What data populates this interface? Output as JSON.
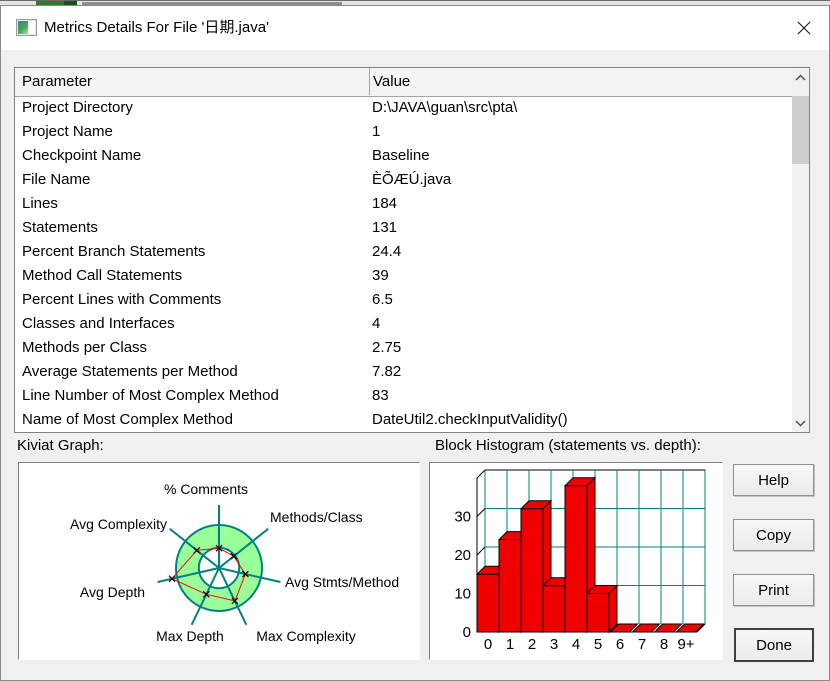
{
  "window": {
    "title": "Metrics Details For File '日期.java'"
  },
  "table": {
    "headers": [
      "Parameter",
      "Value"
    ],
    "rows": [
      [
        "Project Directory",
        "D:\\JAVA\\guan\\src\\pta\\"
      ],
      [
        "Project Name",
        "1"
      ],
      [
        "Checkpoint Name",
        "Baseline"
      ],
      [
        "File Name",
        "ÈÕÆÚ.java"
      ],
      [
        "Lines",
        "184"
      ],
      [
        "Statements",
        "131"
      ],
      [
        "Percent Branch Statements",
        "24.4"
      ],
      [
        "Method Call Statements",
        "39"
      ],
      [
        "Percent Lines with Comments",
        "6.5"
      ],
      [
        "Classes and Interfaces",
        "4"
      ],
      [
        "Methods per Class",
        "2.75"
      ],
      [
        "Average Statements per Method",
        "7.82"
      ],
      [
        "Line Number of Most Complex Method",
        "83"
      ],
      [
        "Name of Most Complex Method",
        "DateUtil2.checkInputValidity()"
      ]
    ]
  },
  "sections": {
    "kiviat_label": "Kiviat Graph:",
    "histogram_label": "Block Histogram (statements vs. depth):"
  },
  "buttons": {
    "help": "Help",
    "copy": "Copy",
    "print": "Print",
    "done": "Done"
  },
  "chart_data": [
    {
      "type": "radar",
      "title": "Kiviat Graph:",
      "axes": [
        "% Comments",
        "Methods/Class",
        "Avg Stmts/Method",
        "Max Complexity",
        "Max Depth",
        "Avg Depth",
        "Avg Complexity"
      ],
      "values_fraction_of_outer_ring": [
        0.46,
        0.44,
        0.63,
        0.85,
        0.68,
        1.12,
        0.66
      ],
      "inner_ring_fraction": 0.47,
      "ring_fill": "#99ff99",
      "spoke_color": "#008080",
      "series_color": "#ff0000",
      "marker_color": "#000000",
      "legend": "none",
      "grid": "radial-rings"
    },
    {
      "type": "bar",
      "title": "Block Histogram (statements vs. depth):",
      "categories": [
        "0",
        "1",
        "2",
        "3",
        "4",
        "5",
        "6",
        "7",
        "8",
        "9+"
      ],
      "values": [
        15,
        24,
        32,
        12,
        38,
        10,
        0,
        0,
        0,
        0
      ],
      "yticks": [
        0,
        10,
        20,
        30
      ],
      "ylim": [
        0,
        40
      ],
      "xlabel": "",
      "ylabel": "",
      "bar_color": "#f10000",
      "grid_color": "#008080",
      "style_3d": true,
      "legend": "none"
    }
  ],
  "colors": {
    "dialog_bg": "#f0f0f0",
    "titlebar_bg": "#ffffff",
    "accent_teal": "#008080",
    "kiviat_green": "#99ff99",
    "bar_red": "#f10000"
  }
}
